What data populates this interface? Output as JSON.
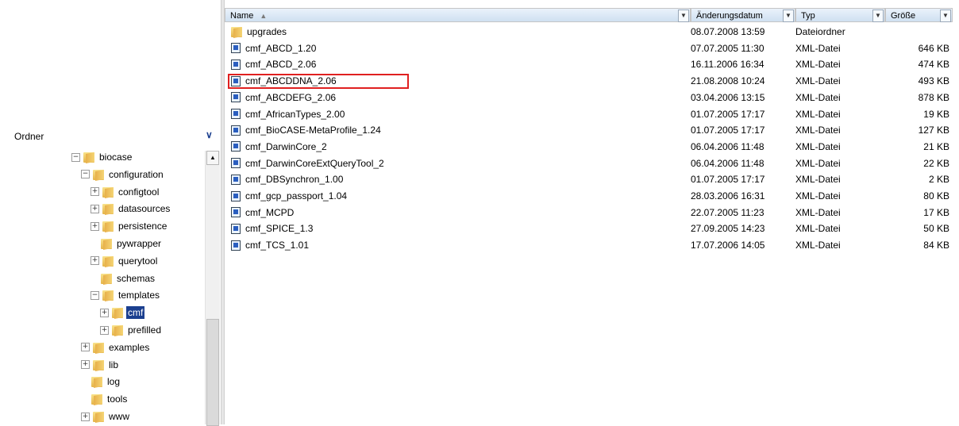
{
  "left_pane": {
    "header": "Ordner",
    "tree": [
      {
        "label": "biocase",
        "expander": "minus",
        "indent": 0
      },
      {
        "label": "configuration",
        "expander": "minus",
        "indent": 1
      },
      {
        "label": "configtool",
        "expander": "plus",
        "indent": 2
      },
      {
        "label": "datasources",
        "expander": "plus",
        "indent": 2
      },
      {
        "label": "persistence",
        "expander": "plus",
        "indent": 2
      },
      {
        "label": "pywrapper",
        "expander": "none",
        "indent": 2
      },
      {
        "label": "querytool",
        "expander": "plus",
        "indent": 2
      },
      {
        "label": "schemas",
        "expander": "none",
        "indent": 2
      },
      {
        "label": "templates",
        "expander": "minus",
        "indent": 2
      },
      {
        "label": "cmf",
        "expander": "plus",
        "indent": 3,
        "selected": true
      },
      {
        "label": "prefilled",
        "expander": "plus",
        "indent": 3
      },
      {
        "label": "examples",
        "expander": "plus",
        "indent": 1
      },
      {
        "label": "lib",
        "expander": "plus",
        "indent": 1
      },
      {
        "label": "log",
        "expander": "none",
        "indent": 1
      },
      {
        "label": "tools",
        "expander": "none",
        "indent": 1
      },
      {
        "label": "www",
        "expander": "plus",
        "indent": 1
      }
    ]
  },
  "columns": {
    "name": "Name",
    "date": "Änderungsdatum",
    "type": "Typ",
    "size": "Größe"
  },
  "files": [
    {
      "name": "upgrades",
      "date": "08.07.2008 13:59",
      "type": "Dateiordner",
      "size": "",
      "kind": "folder"
    },
    {
      "name": "cmf_ABCD_1.20",
      "date": "07.07.2005 11:30",
      "type": "XML-Datei",
      "size": "646 KB",
      "kind": "xml"
    },
    {
      "name": "cmf_ABCD_2.06",
      "date": "16.11.2006 16:34",
      "type": "XML-Datei",
      "size": "474 KB",
      "kind": "xml"
    },
    {
      "name": "cmf_ABCDDNA_2.06",
      "date": "21.08.2008 10:24",
      "type": "XML-Datei",
      "size": "493 KB",
      "kind": "xml",
      "highlighted": true
    },
    {
      "name": "cmf_ABCDEFG_2.06",
      "date": "03.04.2006 13:15",
      "type": "XML-Datei",
      "size": "878 KB",
      "kind": "xml"
    },
    {
      "name": "cmf_AfricanTypes_2.00",
      "date": "01.07.2005 17:17",
      "type": "XML-Datei",
      "size": "19 KB",
      "kind": "xml"
    },
    {
      "name": "cmf_BioCASE-MetaProfile_1.24",
      "date": "01.07.2005 17:17",
      "type": "XML-Datei",
      "size": "127 KB",
      "kind": "xml"
    },
    {
      "name": "cmf_DarwinCore_2",
      "date": "06.04.2006 11:48",
      "type": "XML-Datei",
      "size": "21 KB",
      "kind": "xml"
    },
    {
      "name": "cmf_DarwinCoreExtQueryTool_2",
      "date": "06.04.2006 11:48",
      "type": "XML-Datei",
      "size": "22 KB",
      "kind": "xml"
    },
    {
      "name": "cmf_DBSynchron_1.00",
      "date": "01.07.2005 17:17",
      "type": "XML-Datei",
      "size": "2 KB",
      "kind": "xml"
    },
    {
      "name": "cmf_gcp_passport_1.04",
      "date": "28.03.2006 16:31",
      "type": "XML-Datei",
      "size": "80 KB",
      "kind": "xml"
    },
    {
      "name": "cmf_MCPD",
      "date": "22.07.2005 11:23",
      "type": "XML-Datei",
      "size": "17 KB",
      "kind": "xml"
    },
    {
      "name": "cmf_SPICE_1.3",
      "date": "27.09.2005 14:23",
      "type": "XML-Datei",
      "size": "50 KB",
      "kind": "xml"
    },
    {
      "name": "cmf_TCS_1.01",
      "date": "17.07.2006 14:05",
      "type": "XML-Datei",
      "size": "84 KB",
      "kind": "xml"
    }
  ],
  "colors": {
    "selection": "#1b3f8f",
    "highlight_border": "#e02020",
    "header_gradient_top": "#eaf2fb",
    "header_gradient_bottom": "#cfe0f1"
  }
}
